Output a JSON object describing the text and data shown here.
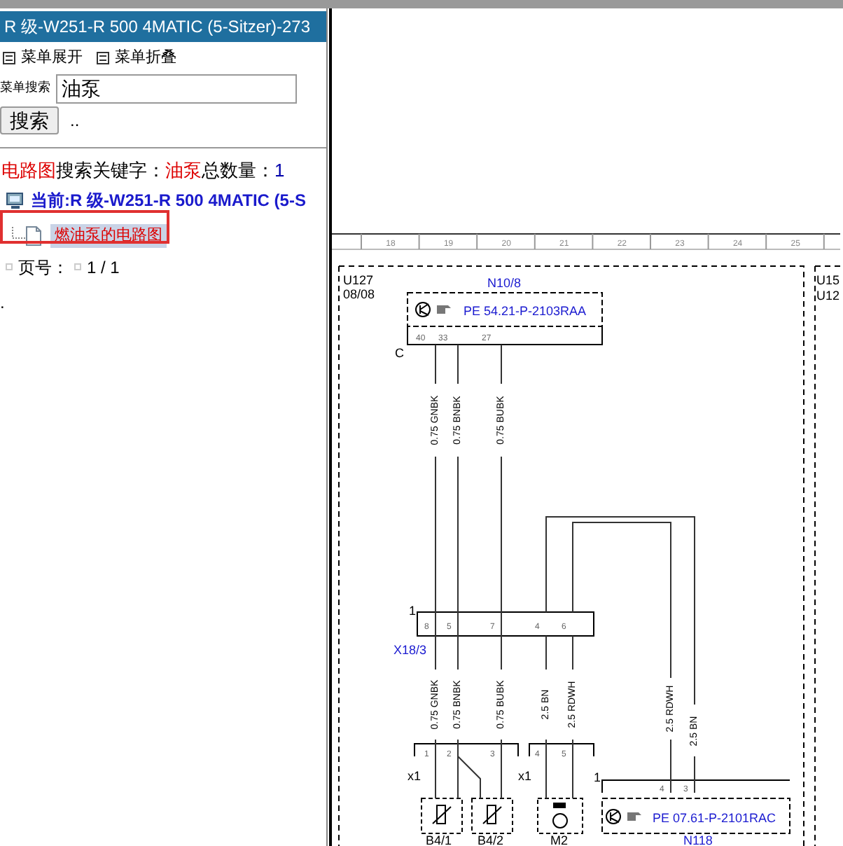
{
  "title_bar": "R 级-W251-R 500 4MATIC (5-Sitzer)-273",
  "menu_links": [
    "菜单展开",
    "菜单折叠"
  ],
  "search": {
    "label": "菜单搜索",
    "value": "油泵",
    "button": "搜索",
    "suffix": ".."
  },
  "result_summary": [
    {
      "text": "电路图",
      "kind": "keyword"
    },
    {
      "text": "搜索关键字：",
      "kind": "plain"
    },
    {
      "text": "油泵",
      "kind": "keyword"
    },
    {
      "text": "总数量：",
      "kind": "plain"
    },
    {
      "text": "1",
      "kind": "count"
    }
  ],
  "tree": {
    "label": "当前:R 级-W251-R 500 4MATIC (5-S",
    "children": [
      {
        "label": "燃油泵的电路图",
        "selected": true
      }
    ]
  },
  "pager": {
    "label": "页号：",
    "value": "1 / 1"
  },
  "footer_mark": ".",
  "diagram": {
    "ruler": [
      "18",
      "19",
      "20",
      "21",
      "22",
      "23",
      "24",
      "25"
    ],
    "labels": [
      {
        "text": "U127",
        "kind": "ref"
      },
      {
        "text": "08/08",
        "kind": "ref"
      },
      {
        "text": "N10/8",
        "kind": "component"
      },
      {
        "text": "PE 54.21-P-2103RAA",
        "kind": "component"
      },
      {
        "text": "40",
        "kind": "pin"
      },
      {
        "text": "33",
        "kind": "pin"
      },
      {
        "text": "27",
        "kind": "pin"
      },
      {
        "text": "C",
        "kind": "ref"
      },
      {
        "text": "0.75 GNBK",
        "kind": "wire"
      },
      {
        "text": "0.75 BNBK",
        "kind": "wire"
      },
      {
        "text": "0.75 BUBK",
        "kind": "wire"
      },
      {
        "text": "U15",
        "kind": "ref"
      },
      {
        "text": "U12",
        "kind": "ref"
      },
      {
        "text": "1",
        "kind": "ref"
      },
      {
        "text": "8",
        "kind": "pin"
      },
      {
        "text": "5",
        "kind": "pin"
      },
      {
        "text": "7",
        "kind": "pin"
      },
      {
        "text": "4",
        "kind": "pin"
      },
      {
        "text": "6",
        "kind": "pin"
      },
      {
        "text": "X18/3",
        "kind": "component"
      },
      {
        "text": "0.75 GNBK",
        "kind": "wire"
      },
      {
        "text": "0.75 BNBK",
        "kind": "wire"
      },
      {
        "text": "0.75 BUBK",
        "kind": "wire"
      },
      {
        "text": "2.5 BN",
        "kind": "wire"
      },
      {
        "text": "2.5 RDWH",
        "kind": "wire"
      },
      {
        "text": "2.5 RDWH",
        "kind": "wire"
      },
      {
        "text": "2.5 BN",
        "kind": "wire"
      },
      {
        "text": "1",
        "kind": "pin"
      },
      {
        "text": "2",
        "kind": "pin"
      },
      {
        "text": "3",
        "kind": "pin"
      },
      {
        "text": "4",
        "kind": "pin"
      },
      {
        "text": "5",
        "kind": "pin"
      },
      {
        "text": "x1",
        "kind": "ref"
      },
      {
        "text": "x1",
        "kind": "ref"
      },
      {
        "text": "1",
        "kind": "ref"
      },
      {
        "text": "4",
        "kind": "pin"
      },
      {
        "text": "3",
        "kind": "pin"
      },
      {
        "text": "PE 07.61-P-2101RAC",
        "kind": "component"
      },
      {
        "text": "B4/1",
        "kind": "ref"
      },
      {
        "text": "B4/2",
        "kind": "ref"
      },
      {
        "text": "M2",
        "kind": "ref"
      },
      {
        "text": "N118",
        "kind": "component"
      }
    ]
  }
}
